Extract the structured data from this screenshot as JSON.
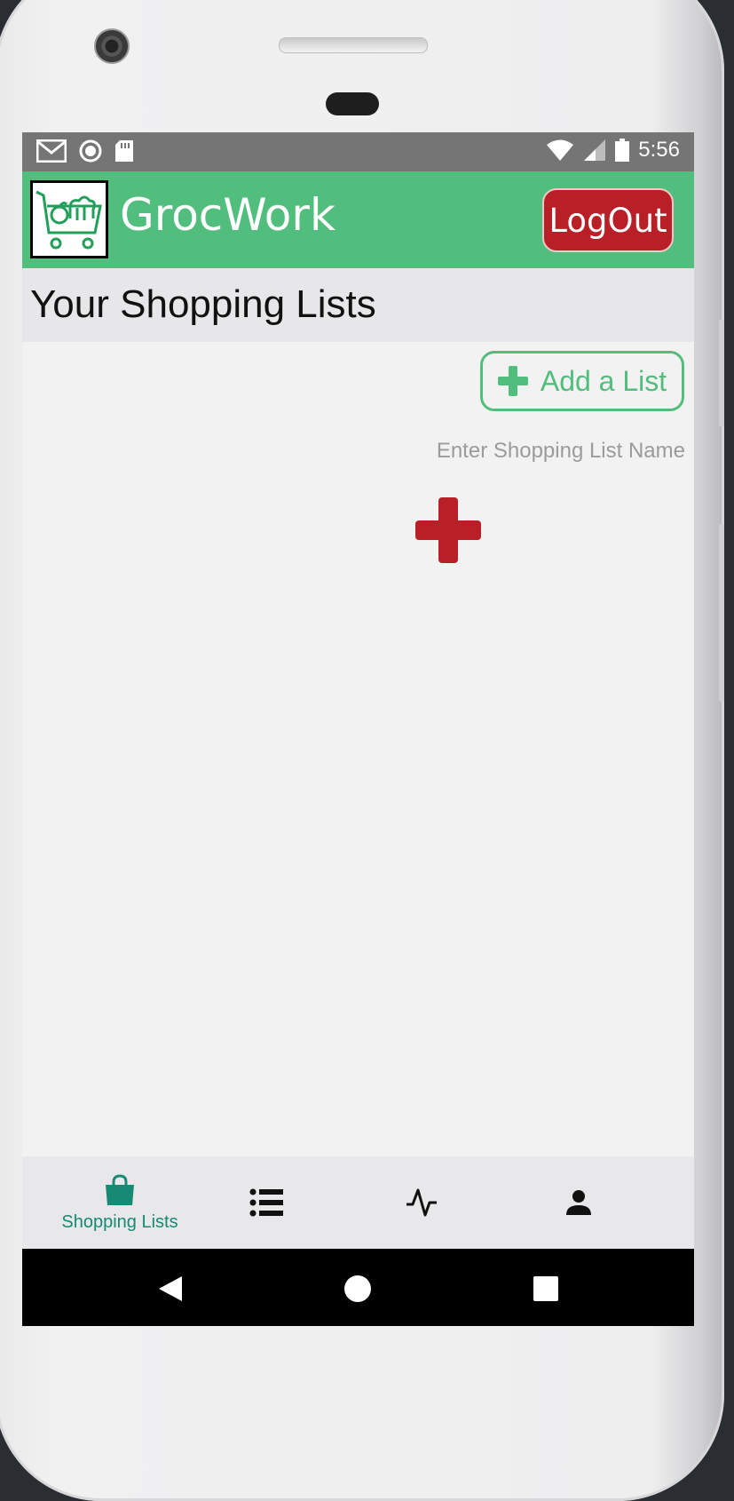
{
  "status_bar": {
    "time": "5:56",
    "left_icons": [
      "gmail-icon",
      "record-icon",
      "sd-card-icon"
    ],
    "right_icons": [
      "wifi-icon",
      "signal-icon",
      "battery-icon"
    ]
  },
  "app_bar": {
    "title": "GrocWork",
    "logout_label": "LogOut",
    "logo": "grocery-cart-logo"
  },
  "section": {
    "title": "Your Shopping Lists"
  },
  "add_list": {
    "button_label": "Add a List",
    "input_placeholder": "Enter Shopping List Name",
    "input_value": ""
  },
  "bottom_nav": {
    "items": [
      {
        "icon": "shopping-bag-icon",
        "label": "Shopping Lists",
        "active": true
      },
      {
        "icon": "list-icon",
        "label": "",
        "active": false
      },
      {
        "icon": "activity-icon",
        "label": "",
        "active": false
      },
      {
        "icon": "person-icon",
        "label": "",
        "active": false
      }
    ]
  },
  "colors": {
    "brand_green": "#52be7d",
    "logout_red": "#b81f26",
    "active_nav_teal": "#168a74",
    "status_bar_gray": "#757575"
  }
}
